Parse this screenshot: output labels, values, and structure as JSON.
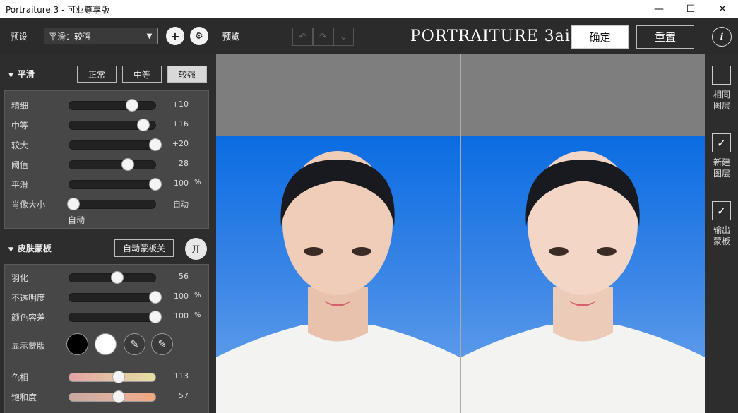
{
  "window": {
    "title": "Portraiture 3 - 可业尊享版",
    "minimize": "—",
    "maximize": "☐",
    "close": "✕"
  },
  "toolbar": {
    "preset_label": "预设",
    "preset_value": "平滑：较强",
    "add_icon": "+",
    "settings_icon": "⚙",
    "preview_label": "预览",
    "undo_icon": "↶",
    "redo_icon": "↷",
    "history_icon": "⌄",
    "brand": "PORTRAITURE 3ai",
    "ok_label": "确定",
    "reset_label": "重置",
    "info_icon": "i"
  },
  "smoothing": {
    "title": "平滑",
    "modes": [
      "正常",
      "中等",
      "较强"
    ],
    "active_mode": "较强",
    "sliders": [
      {
        "label": "精细",
        "value": "+10",
        "unit": "",
        "position": 0.73
      },
      {
        "label": "中等",
        "value": "+16",
        "unit": "",
        "position": 0.86
      },
      {
        "label": "较大",
        "value": "+20",
        "unit": "",
        "position": 1.0
      },
      {
        "label": "阈值",
        "value": "28",
        "unit": "",
        "position": 0.68
      },
      {
        "label": "平滑",
        "value": "100",
        "unit": "%",
        "position": 1.0
      },
      {
        "label": "肖像大小",
        "value": "自动",
        "unit": "",
        "position": 0.05
      }
    ],
    "portrait_size_note": "自动"
  },
  "skin_mask": {
    "title": "皮肤蒙板",
    "auto_mask_label": "自动蒙板关",
    "on_label": "开",
    "sliders": [
      {
        "label": "羽化",
        "value": "56",
        "unit": "",
        "position": 0.56
      },
      {
        "label": "不透明度",
        "value": "100",
        "unit": "%",
        "position": 1.0
      },
      {
        "label": "颜色容差",
        "value": "100",
        "unit": "%",
        "position": 1.0
      }
    ],
    "show_mask_label": "显示蒙版",
    "hue": {
      "label": "色相",
      "value": "113",
      "position": 0.57
    },
    "saturation": {
      "label": "饱和度",
      "value": "57",
      "position": 0.57
    }
  },
  "output_options": [
    {
      "label_line1": "相同",
      "label_line2": "图层",
      "checked": false
    },
    {
      "label_line1": "新建",
      "label_line2": "图层",
      "checked": true
    },
    {
      "label_line1": "输出",
      "label_line2": "蒙板",
      "checked": true
    }
  ],
  "colors": {
    "accent_bg": "#2d2d2d",
    "panel": "#474747",
    "photo_blue": "#0a6ce2"
  }
}
